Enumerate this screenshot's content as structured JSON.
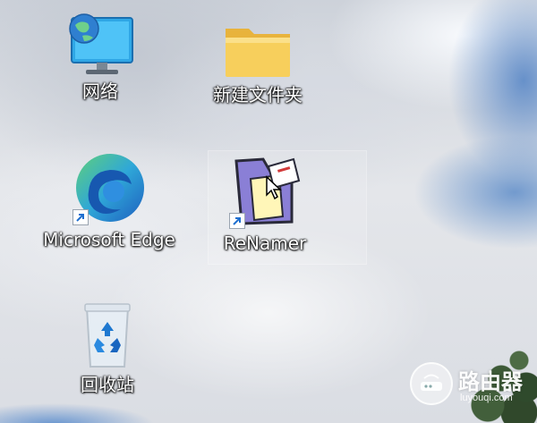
{
  "desktop": {
    "icons": [
      {
        "label": "网络",
        "icon": "network-icon"
      },
      {
        "label": "新建文件夹",
        "icon": "folder-icon"
      },
      {
        "label": "Microsoft Edge",
        "icon": "edge-icon"
      },
      {
        "label": "ReNamer",
        "icon": "renamer-icon"
      },
      {
        "label": "回收站",
        "icon": "recycle-bin-icon"
      }
    ]
  },
  "watermark": {
    "text": "路由器",
    "subtext": "luyouqi.com"
  },
  "colors": {
    "sky_blue": "#6c96cc",
    "folder_yellow": "#f5c84a",
    "edge_blue": "#1e7fd8",
    "edge_green": "#5fd07a"
  }
}
